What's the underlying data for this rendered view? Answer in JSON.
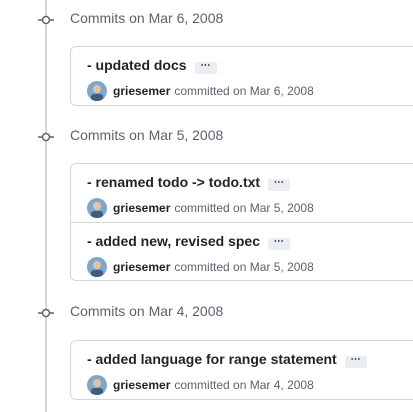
{
  "groups": [
    {
      "title": "Commits on Mar 6, 2008",
      "commits": [
        {
          "message": "- updated docs",
          "author": "griesemer",
          "meta": "committed on Mar 6, 2008"
        }
      ]
    },
    {
      "title": "Commits on Mar 5, 2008",
      "commits": [
        {
          "message": "- renamed todo -> todo.txt",
          "author": "griesemer",
          "meta": "committed on Mar 5, 2008"
        },
        {
          "message": "- added new, revised spec",
          "author": "griesemer",
          "meta": "committed on Mar 5, 2008"
        }
      ]
    },
    {
      "title": "Commits on Mar 4, 2008",
      "commits": [
        {
          "message": "- added language for range statement",
          "author": "griesemer",
          "meta": "committed on Mar 4, 2008"
        }
      ]
    }
  ],
  "ellipsis": "⋯",
  "icons": {
    "node": "git-commit-icon",
    "avatar": "user-avatar"
  },
  "colors": {
    "border": "#d0d7de",
    "muted": "#59636e",
    "text": "#1f2328"
  }
}
